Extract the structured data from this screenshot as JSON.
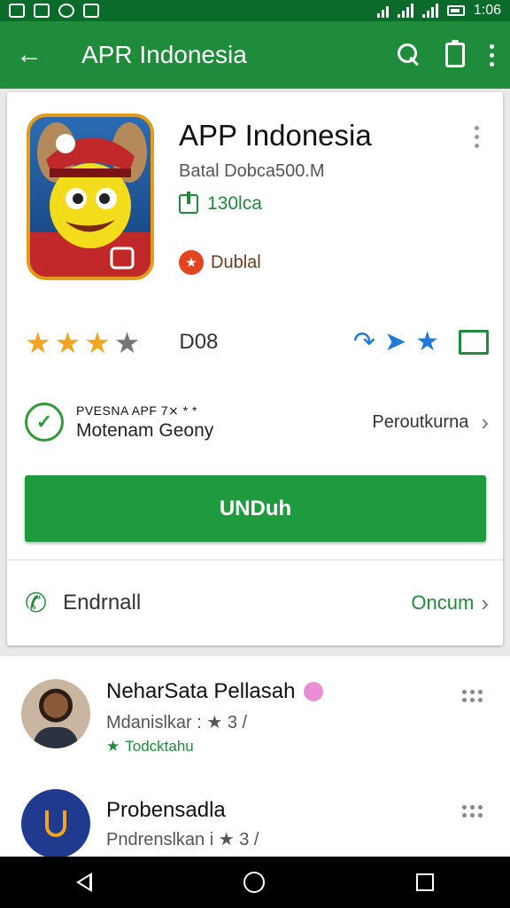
{
  "status_bar": {
    "time": "1:06"
  },
  "app_bar": {
    "title": "APR Indonesia",
    "back_icon": "arrow-back-icon"
  },
  "app": {
    "name": "APP Indonesia",
    "meta_line": "Batal Dobca500.M",
    "size_line": "130lca",
    "badge_label": "Dublal",
    "rating_count": "D08",
    "stars": 3.5
  },
  "developer": {
    "small_label": "PVESNA APF 7⨯ * *",
    "name": "Motenam Geony",
    "link": "Peroutkurna"
  },
  "install_label": "UNDuh",
  "call": {
    "label": "Endrnall",
    "link": "Oncum"
  },
  "reviews": [
    {
      "name": "NeharSata Pellasah",
      "meta": "Mdanislkar : ★ 3 /",
      "tag": "Todcktahu"
    },
    {
      "name": "Probensadla",
      "meta": "Pndrenslkan i ★ 3 /"
    }
  ],
  "colors": {
    "primary": "#1f8c3b",
    "status": "#0b6b2a",
    "star": "#f0a623",
    "install": "#1f9a3e"
  }
}
